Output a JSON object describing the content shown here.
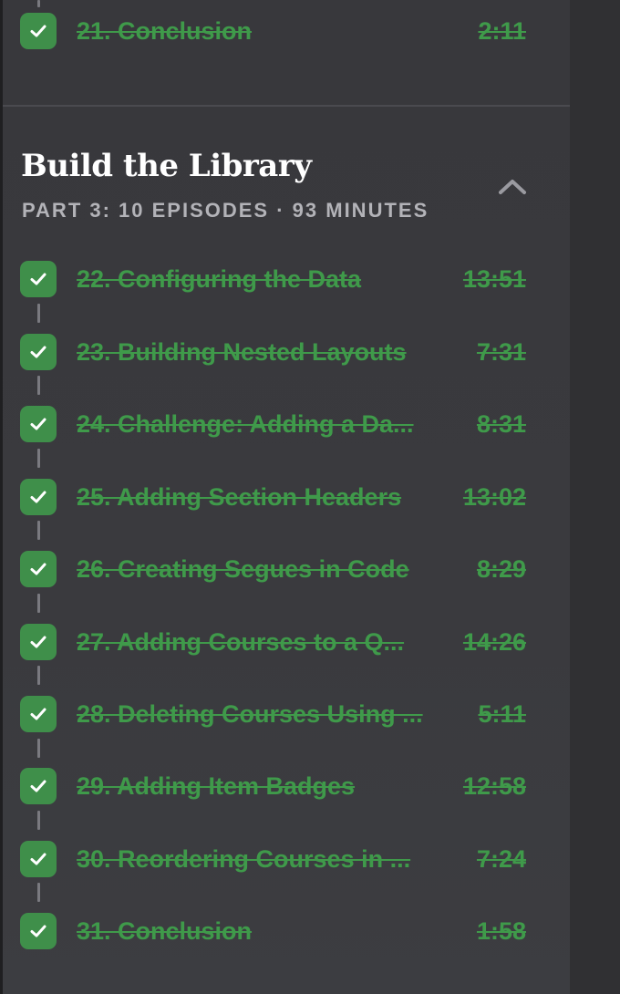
{
  "prev_section": {
    "last_episode": {
      "title": "21. Conclusion",
      "duration": "2:11"
    }
  },
  "section": {
    "title": "Build the Library",
    "subtitle": "PART 3: 10 EPISODES · 93 MINUTES",
    "collapse_icon": "chevron-up-icon"
  },
  "episodes": [
    {
      "title": "22. Configuring the Data",
      "duration": "13:51"
    },
    {
      "title": "23. Building Nested Layouts",
      "duration": "7:31"
    },
    {
      "title": "24. Challenge: Adding a Da...",
      "duration": "8:31"
    },
    {
      "title": "25. Adding Section Headers",
      "duration": "13:02"
    },
    {
      "title": "26. Creating Segues in Code",
      "duration": "8:29"
    },
    {
      "title": "27. Adding Courses to a Q...",
      "duration": "14:26"
    },
    {
      "title": "28. Deleting Courses Using ...",
      "duration": "5:11"
    },
    {
      "title": "29. Adding Item Badges",
      "duration": "12:58"
    },
    {
      "title": "30. Reordering Courses in ...",
      "duration": "7:24"
    },
    {
      "title": "31. Conclusion",
      "duration": "1:58"
    }
  ],
  "colors": {
    "completed_green": "#3f9a4a",
    "check_bg": "#3f8f4a",
    "panel_bg": "#38383c"
  }
}
